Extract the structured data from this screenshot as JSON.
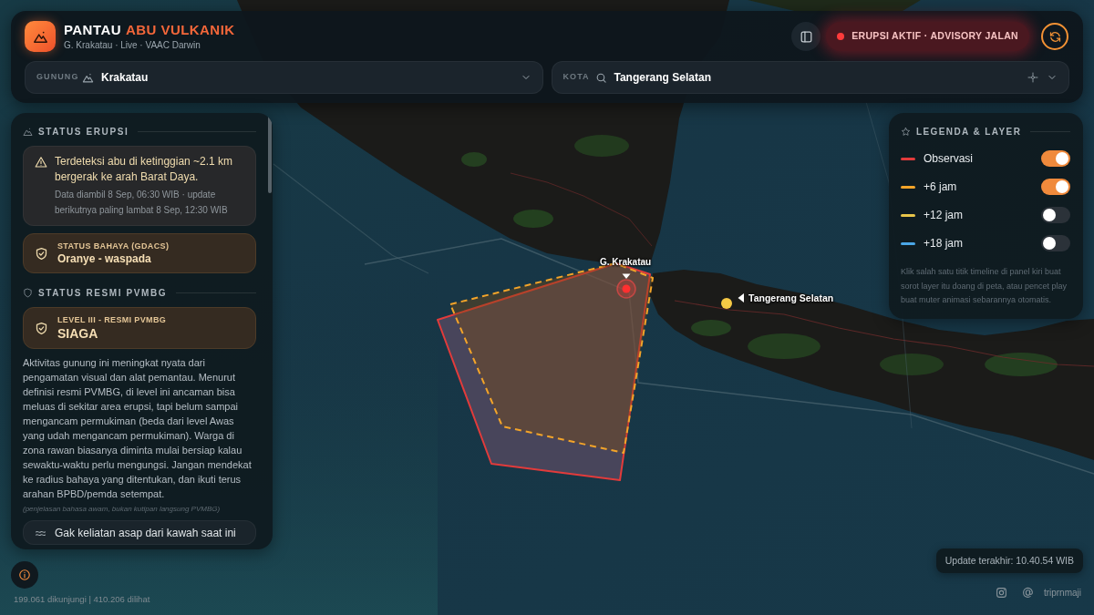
{
  "header": {
    "brand": "PANTAU",
    "brand_accent": "ABU VULKANIK",
    "subtitle": "G. Krakatau · Live · VAAC Darwin",
    "status": "ERUPSI AKTIF · ADVISORY JALAN"
  },
  "filters": [
    {
      "kind": "dropdown",
      "label": "GUNUNG",
      "value": "Krakatau"
    },
    {
      "kind": "search",
      "label": "KOTA",
      "value": "Tangerang Selatan"
    }
  ],
  "sidebar": {
    "eruption": {
      "heading": "STATUS ERUPSI",
      "alert": "Terdeteksi abu di ketinggian ~2.1 km bergerak ke arah Barat Daya.",
      "alert_note": "Data diambil 8 Sep, 06:30 WIB · update berikutnya paling lambat 8 Sep, 12:30 WIB",
      "hazard": {
        "label": "STATUS BAHAYA (GDACS)",
        "value": "Oranye - waspada"
      }
    },
    "official": {
      "heading": "STATUS RESMI PVMBG",
      "level": {
        "label": "LEVEL III - RESMI PVMBG",
        "value": "SIAGA"
      },
      "explanation": "Aktivitas gunung ini meningkat nyata dari pengamatan visual dan alat pemantau. Menurut definisi resmi PVMBG, di level ini ancaman bisa meluas di sekitar area erupsi, tapi belum sampai mengancam permukiman (beda dari level Awas yang udah mengancam permukiman). Warga di zona rawan biasanya diminta mulai bersiap kalau sewaktu-waktu perlu mengungsi. Jangan mendekat ke radius bahaya yang ditentukan, dan ikuti terus arahan BPBD/pemda setempat.",
      "disclaimer": "(penjelasan bahasa awam, bukan kutipan langsung PVMBG)"
    },
    "observation": "Gak keliatan asap dari kawah saat ini"
  },
  "map": {
    "volcano_label": "G. Krakatau",
    "city_label": "Tangerang Selatan"
  },
  "legend": {
    "title": "LEGENDA & LAYER",
    "layers": [
      {
        "label": "Observasi",
        "color": "#e23b3b",
        "on": true
      },
      {
        "label": "+6 jam",
        "color": "#f3a429",
        "on": true
      },
      {
        "label": "+12 jam",
        "color": "#e8c54a",
        "on": false
      },
      {
        "label": "+18 jam",
        "color": "#4aa6e6",
        "on": false
      }
    ],
    "hint": "Klik salah satu titik timeline di panel kiri buat sorot layer itu doang di peta, atau pencet play buat muter animasi sebarannya otomatis."
  },
  "footer": {
    "last_update": "Update terakhir: 10.40.54 WIB",
    "stats": "199.061 dikunjungi | 410.206 dilihat",
    "handle": "triprnmaji"
  }
}
